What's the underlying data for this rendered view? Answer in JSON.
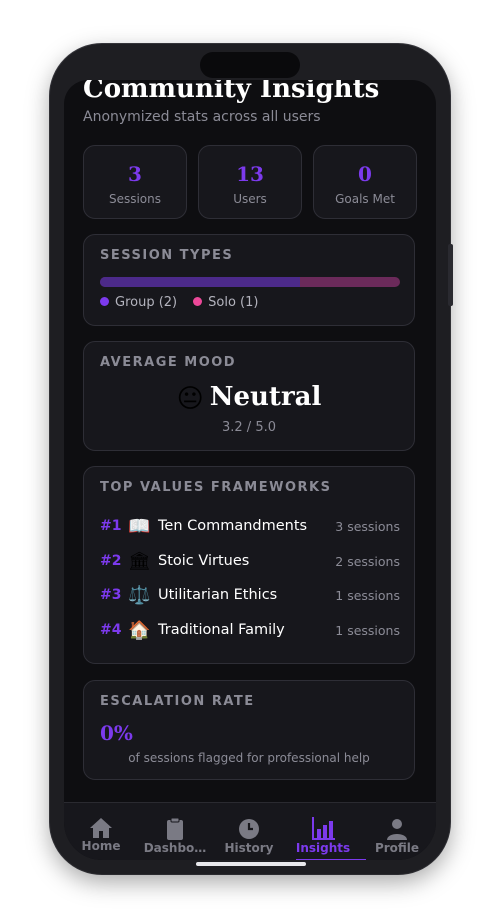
{
  "header": {
    "title": "Community Insights",
    "subtitle": "Anonymized stats across all users"
  },
  "stats": [
    {
      "value": "3",
      "label": "Sessions"
    },
    {
      "value": "13",
      "label": "Users"
    },
    {
      "value": "0",
      "label": "Goals Met"
    }
  ],
  "session_types": {
    "heading": "SESSION TYPES",
    "group_fraction": 0.6667,
    "colors": {
      "group": "#4c2a8a",
      "solo": "#6b2a5a",
      "group_dot": "#7c3aed",
      "solo_dot": "#ec4899"
    },
    "legend": [
      {
        "label": "Group (2)"
      },
      {
        "label": "Solo (1)"
      }
    ]
  },
  "mood": {
    "heading": "AVERAGE MOOD",
    "emoji": "😐",
    "label": "Neutral",
    "score": "3.2 / 5.0"
  },
  "frameworks": {
    "heading": "TOP VALUES FRAMEWORKS",
    "items": [
      {
        "rank": "#1",
        "icon": "📖",
        "name": "Ten Commandments",
        "count": "3 sessions"
      },
      {
        "rank": "#2",
        "icon": "🏛",
        "name": "Stoic Virtues",
        "count": "2 sessions"
      },
      {
        "rank": "#3",
        "icon": "⚖️",
        "name": "Utilitarian Ethics",
        "count": "1 sessions"
      },
      {
        "rank": "#4",
        "icon": "🏠",
        "name": "Traditional Family",
        "count": "1 sessions"
      }
    ]
  },
  "escalation": {
    "heading": "ESCALATION RATE",
    "value": "0%",
    "note": "of sessions flagged for professional help"
  },
  "nav": {
    "items": [
      {
        "label": "Home",
        "icon": "home-icon"
      },
      {
        "label": "Dashbo…",
        "icon": "clipboard-icon"
      },
      {
        "label": "History",
        "icon": "clock-icon"
      },
      {
        "label": "Insights",
        "icon": "bar-chart-icon",
        "active": true
      },
      {
        "label": "Profile",
        "icon": "person-icon"
      }
    ]
  },
  "accent_color": "#7c3aed"
}
